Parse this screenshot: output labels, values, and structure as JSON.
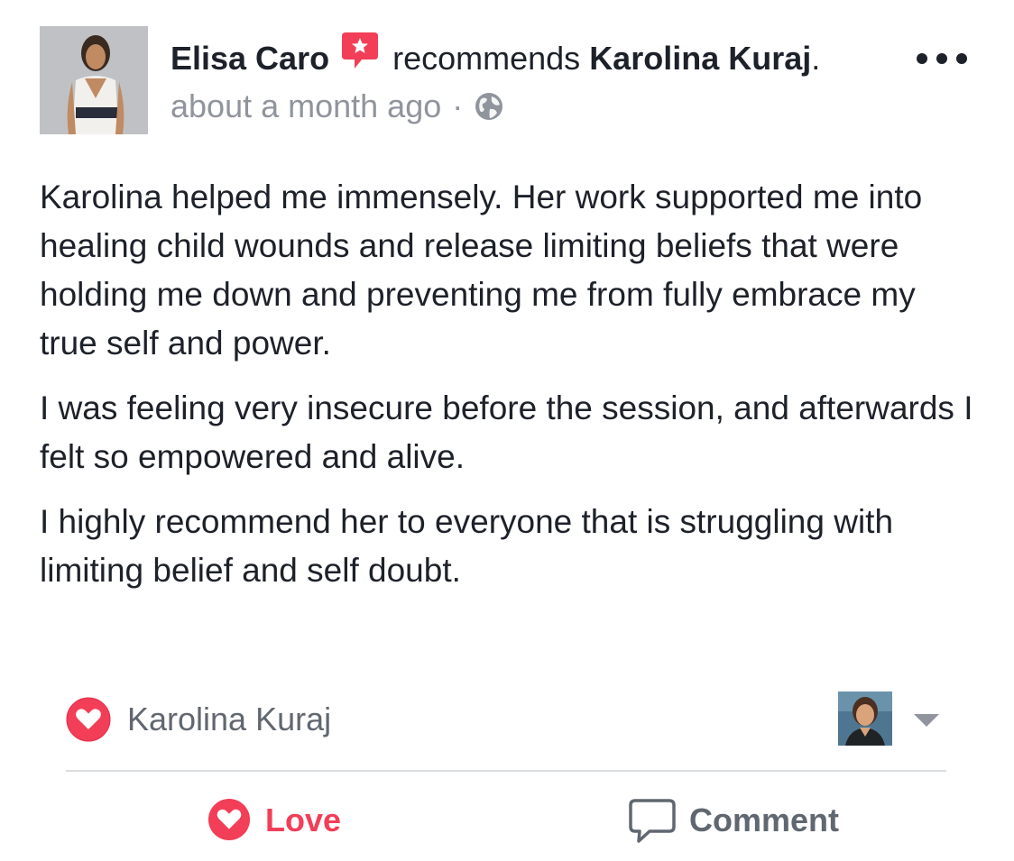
{
  "post": {
    "author": "Elisa Caro",
    "verb": "recommends",
    "target": "Karolina Kuraj",
    "target_suffix": ".",
    "time": "about a month ago",
    "separator": "·",
    "privacy_icon": "globe-icon",
    "more_icon": "more-options-icon",
    "recommend_badge_icon": "recommendation-star-icon",
    "paragraphs": [
      "Karolina helped me immensely. Her work supported me into healing child wounds and release limiting beliefs that were holding me down and preventing me from fully embrace my true self and power.",
      "I was feeling very insecure before the session, and afterwards I felt so empowered and alive.",
      "I highly recommend her to everyone that is struggling with limiting belief and self doubt."
    ]
  },
  "reactions": {
    "reactor_name": "Karolina Kuraj",
    "reaction_icon": "love-reaction-icon"
  },
  "actions": {
    "love_label": "Love",
    "comment_label": "Comment"
  },
  "colors": {
    "love": "#f33e58",
    "text": "#1d2129",
    "secondary": "#90949c",
    "divider": "#dadde1"
  }
}
